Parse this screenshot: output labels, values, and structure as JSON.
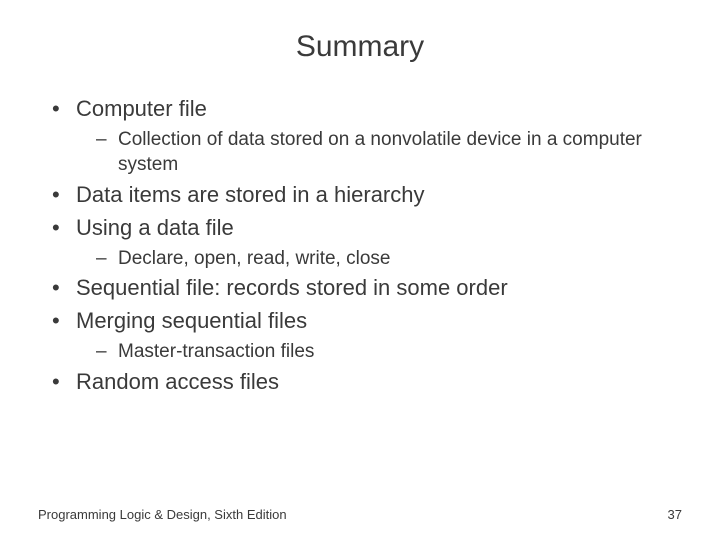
{
  "title": "Summary",
  "bullets": {
    "b0": "Computer file",
    "b0_s0": "Collection of data stored on a nonvolatile device in a computer system",
    "b1": "Data items are stored in a hierarchy",
    "b2": "Using a data file",
    "b2_s0": "Declare, open, read, write, close",
    "b3": "Sequential file: records stored in some order",
    "b4": "Merging sequential files",
    "b4_s0": "Master-transaction files",
    "b5": "Random access files"
  },
  "footer": {
    "left": "Programming Logic & Design, Sixth Edition",
    "right": "37"
  }
}
